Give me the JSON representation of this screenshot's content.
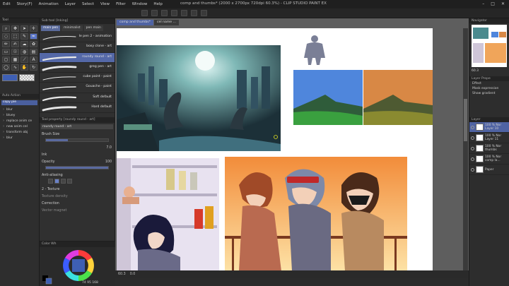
{
  "window": {
    "title": "comp and thumbs* (2000 x 2700px 720dpi 60.3%) - CLIP STUDIO PAINT EX",
    "controls": [
      "–",
      "□",
      "✕"
    ]
  },
  "menu": [
    "Edit",
    "Story(F)",
    "Animation",
    "Layer",
    "Select",
    "View",
    "Filter",
    "Window",
    "Help"
  ],
  "tool_panel": {
    "header": "Tool",
    "color_header": "",
    "layer_header": "Auto Action",
    "selected_action": "copy pie",
    "actions": [
      "blur",
      "bluey",
      "replace anim ce",
      "new anim cel",
      "transform obj",
      "blur"
    ]
  },
  "sub_tool": {
    "header": "Sub tool  [Inking]",
    "tabs": [
      "main pen",
      "minimalist",
      "pen main"
    ],
    "brushes": [
      {
        "label": "le pen 2 - animation"
      },
      {
        "label": "boxy clone - art"
      },
      {
        "label": "roundy round - art"
      },
      {
        "label": "greg pen - art"
      },
      {
        "label": "cube paint - paint"
      },
      {
        "label": "Gouache - paint"
      },
      {
        "label": "Soft default"
      },
      {
        "label": "Hard default"
      }
    ],
    "active_brush_index": 2
  },
  "tool_property": {
    "header": "Tool property [roundy round - art]",
    "selected": "roundy round - art",
    "brush_size_label": "Brush Size",
    "brush_size_value": "7.0",
    "brush_size_level": 0.35,
    "ink_label": "Ink",
    "opacity_label": "Opacity",
    "opacity_value": "100",
    "opacity_level": 1.0,
    "antialiasing_label": "Anti-aliasing",
    "texture_label": "2 - Texture",
    "texture_density": "Texture density",
    "correction_label": "Correction",
    "vector_magnet": "Vector magnet"
  },
  "color_wheel": {
    "header": "Color Wh",
    "readout": "74   95   168"
  },
  "canvas": {
    "tabs": [
      "comp and thumbs*",
      "cel name ..."
    ],
    "status_zoom": "60.3",
    "status_coords": "0.0"
  },
  "navigator": {
    "header": "Navigator",
    "zoom": "60.3"
  },
  "layer_property": {
    "header": "Layer Prope",
    "effect": "Effect",
    "mask_expression": "Mask expression",
    "show_gradient": "Show gradient"
  },
  "layers": {
    "header": "Layer",
    "items": [
      {
        "name": "100 % Nor\nLayer 10"
      },
      {
        "name": "100 % Nor\nLayer 11"
      },
      {
        "name": "100 % Nor\nthumbs"
      },
      {
        "name": "100 % Nor\ncomp la..."
      },
      {
        "name": "Paper"
      }
    ]
  },
  "colors": {
    "main": "#3e5fb4",
    "accent": "#5468a7"
  }
}
